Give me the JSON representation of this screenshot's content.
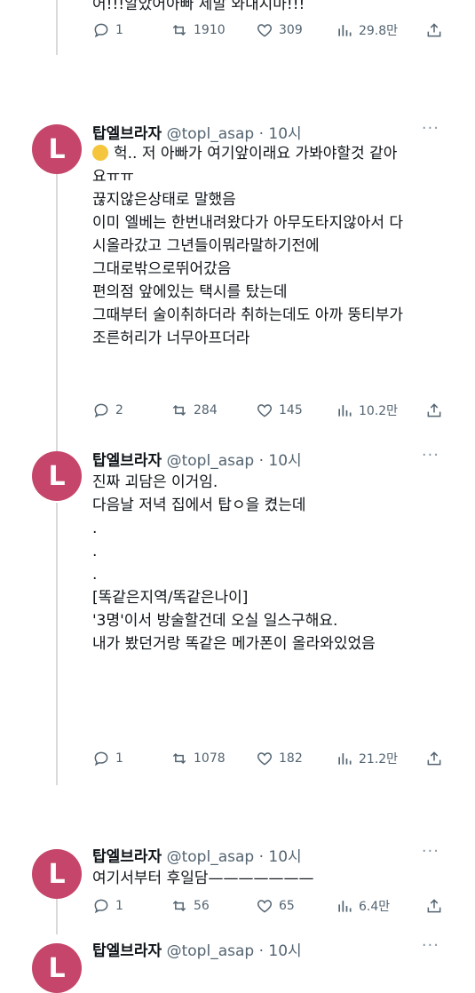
{
  "top_partial": {
    "text": "어!!!알았어아빠 제발 와내지마!!!",
    "stats": {
      "replies": "1",
      "retweets": "1910",
      "likes": "309",
      "views": "29.8만"
    }
  },
  "tweets": [
    {
      "avatar_letter": "L",
      "name": "탑엘브라자",
      "handle_time": "@topl_asap · 10시",
      "more": "···",
      "lines": [
        "헉.. 저 아빠가 여기앞이래요 가봐야할것 같아",
        "요ㅠㅠ",
        "",
        "끊지않은상태로 말했음",
        "이미 엘베는 한번내려왔다가 아무도타지않아서 다",
        "시올라갔고 그년들이뭐라말하기전에",
        "그대로밖으로뛰어갔음",
        "",
        "편의점 앞에있는 택시를 탔는데",
        "그때부터 술이취하더라 취하는데도 아까 뚱티부가",
        "조른허리가 너무아프더라"
      ],
      "stats": {
        "replies": "2",
        "retweets": "284",
        "likes": "145",
        "views": "10.2만"
      }
    },
    {
      "avatar_letter": "L",
      "name": "탑엘브라자",
      "handle_time": "@topl_asap · 10시",
      "more": "···",
      "lines": [
        "진짜 괴담은 이거임.",
        "",
        "다음날 저녁 집에서 탑ㅇ을 켰는데",
        "",
        ".",
        ".",
        ".",
        "",
        "[똑같은지역/똑같은나이]",
        "'3명'이서 방술할건데 오실 일스구해요.",
        "",
        "내가 봤던거랑 똑같은 메가폰이 올라와있었음"
      ],
      "stats": {
        "replies": "1",
        "retweets": "1078",
        "likes": "182",
        "views": "21.2만"
      }
    },
    {
      "avatar_letter": "L",
      "name": "탑엘브라자",
      "handle_time": "@topl_asap · 10시",
      "more": "···",
      "lines": [
        "여기서부터 후일담———————"
      ],
      "stats": {
        "replies": "1",
        "retweets": "56",
        "likes": "65",
        "views": "6.4만"
      }
    },
    {
      "avatar_letter": "L",
      "name": "탑엘브라자",
      "handle_time": "@topl_asap · 10시",
      "more": "···",
      "lines": [],
      "stats": {}
    }
  ]
}
